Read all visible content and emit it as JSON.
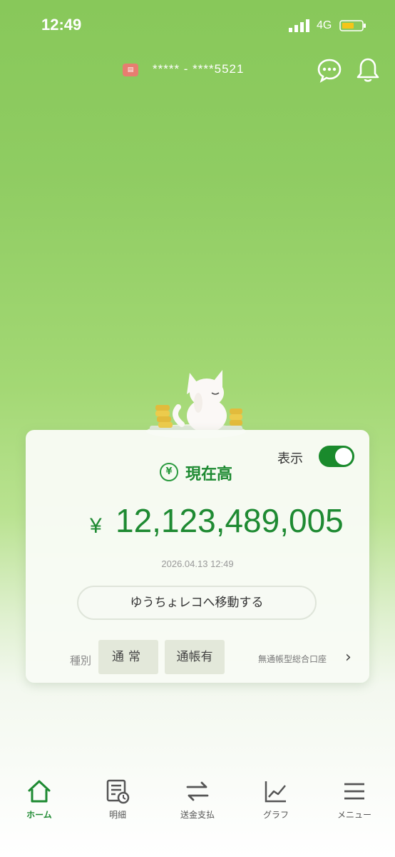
{
  "status_bar": {
    "time": "12:49",
    "network": "4G"
  },
  "header": {
    "account_number": "***** - ****5521"
  },
  "balance_card": {
    "toggle_label": "表示",
    "toggle_on": true,
    "title": "現在高",
    "currency_symbol": "¥",
    "amount": "12,123,489,005",
    "timestamp": "2026.04.13 12:49",
    "move_button_label": "ゆうちょレコへ移動する",
    "type_label": "種別",
    "tags": [
      "通常",
      "通帳有"
    ],
    "account_type": "無通帳型総合口座"
  },
  "tabbar": {
    "items": [
      {
        "label": "ホーム",
        "icon": "home-icon",
        "active": true
      },
      {
        "label": "明細",
        "icon": "statement-icon",
        "active": false
      },
      {
        "label": "送金支払",
        "icon": "transfer-icon",
        "active": false
      },
      {
        "label": "グラフ",
        "icon": "graph-icon",
        "active": false
      },
      {
        "label": "メニュー",
        "icon": "menu-icon",
        "active": false
      }
    ]
  },
  "colors": {
    "primary_green": "#1e8a32",
    "background_green": "#8fcc62"
  }
}
